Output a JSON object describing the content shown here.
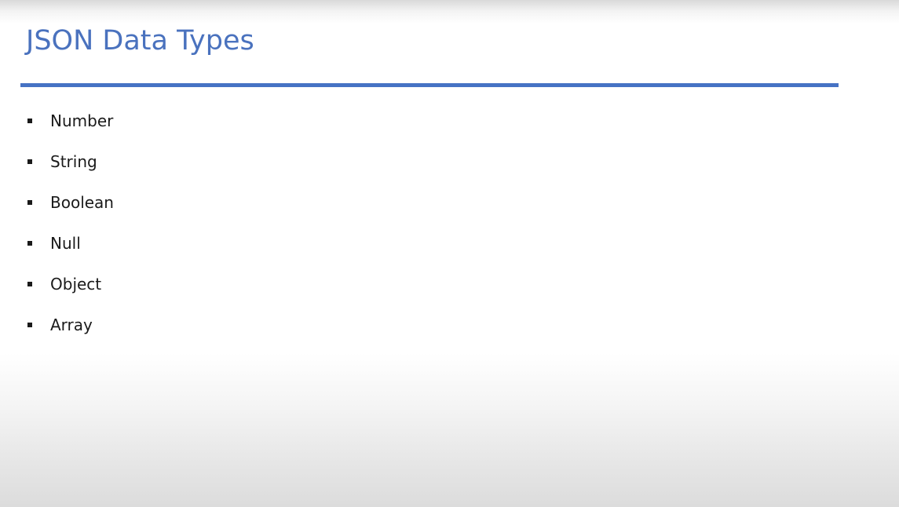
{
  "slide": {
    "title": "JSON Data Types",
    "title_color": "#4a72be",
    "rule_color": "#4672c4",
    "bullets": [
      {
        "label": "Number"
      },
      {
        "label": "String"
      },
      {
        "label": "Boolean"
      },
      {
        "label": "Null"
      },
      {
        "label": "Object"
      },
      {
        "label": "Array"
      }
    ]
  }
}
